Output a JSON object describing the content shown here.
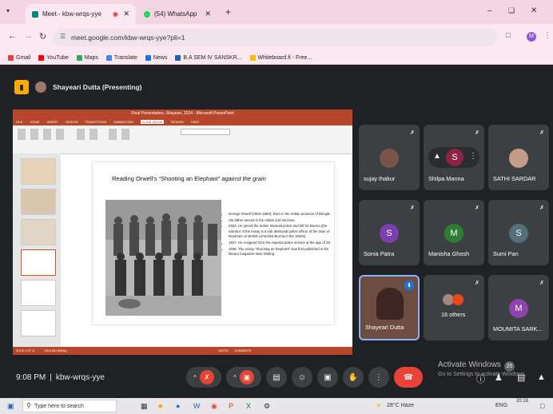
{
  "browser": {
    "tabs": [
      {
        "label": "Meet - kbw-wrqs-yye",
        "active": true
      },
      {
        "label": "(54) WhatsApp",
        "active": false
      }
    ],
    "url": "meet.google.com/kbw-wrqs-yye?pli=1",
    "bookmarks": [
      "Gmail",
      "YouTube",
      "Maps",
      "Translate",
      "News",
      "B.A SEM IV SANSKR...",
      "Whiteboard.fi - Free..."
    ],
    "accent": "#f4d6e2"
  },
  "meet": {
    "presenter_label": "Shayeari Dutta (Presenting)",
    "time": "9:08 PM",
    "meeting_code": "kbw-wrqs-yye",
    "activate_title": "Activate Windows",
    "activate_sub": "Go to Settings to activate Windows.",
    "badge_count": "25",
    "participants": [
      {
        "name": "sujay thakur",
        "initial": "",
        "color": "#3c4043"
      },
      {
        "name": "Shilpa Manna",
        "initial": "S",
        "color": "#8e2444"
      },
      {
        "name": "SATHI SARDAR",
        "initial": "",
        "color": "#3c4043"
      },
      {
        "name": "Sonia Patra",
        "initial": "S",
        "color": "#7b3fb1"
      },
      {
        "name": "Manisha Ghosh",
        "initial": "M",
        "color": "#2e7d32"
      },
      {
        "name": "Sumi Pan",
        "initial": "S",
        "color": "#546e7a"
      },
      {
        "name": "Shayeari Dutta",
        "initial": "",
        "color": "#8d6e63"
      },
      {
        "name": "16 others",
        "initial": "",
        "color": "#3c4043"
      },
      {
        "name": "MOUMITA SARK...",
        "initial": "M",
        "color": "#8e44ad"
      }
    ]
  },
  "presentation": {
    "window_title": "Final Presentation, Shayeari, 2024 - Microsoft PowerPoint",
    "menu": [
      "FILE",
      "HOME",
      "INSERT",
      "DESIGN",
      "TRANSITIONS",
      "ANIMATIONS",
      "SLIDE SHOW",
      "REVIEW",
      "VIEW"
    ],
    "slide_title_main": "Reading Orwell's “Shooting an Elephant” ",
    "slide_title_em": "against the grain",
    "bullets": [
      "George Orwell (1903–1950)- Born in the Indian province of Bengal.",
      "His father served in the Indian civil services.",
      "1922- He joined the Indian Imperial police and left for Burma (the narrator of the essay is a sub divisional police officer of the town of Moulmein in British-controlled Burma in the 1920s).",
      "1927- He resigned from the imperial police service at the age of 25.",
      "1936- The essay “Shooting an Elephant” was first published in the literary magazine New Writing."
    ],
    "status_left": "SLIDE 4 OF 11",
    "status_lang": "ENGLISH (INDIA)",
    "status_notes": "NOTES",
    "status_comments": "COMMENTS"
  },
  "taskbar": {
    "search_placeholder": "Type here to search",
    "weather": "28°C Haze",
    "lang": "ENG",
    "clock": "20:18"
  }
}
